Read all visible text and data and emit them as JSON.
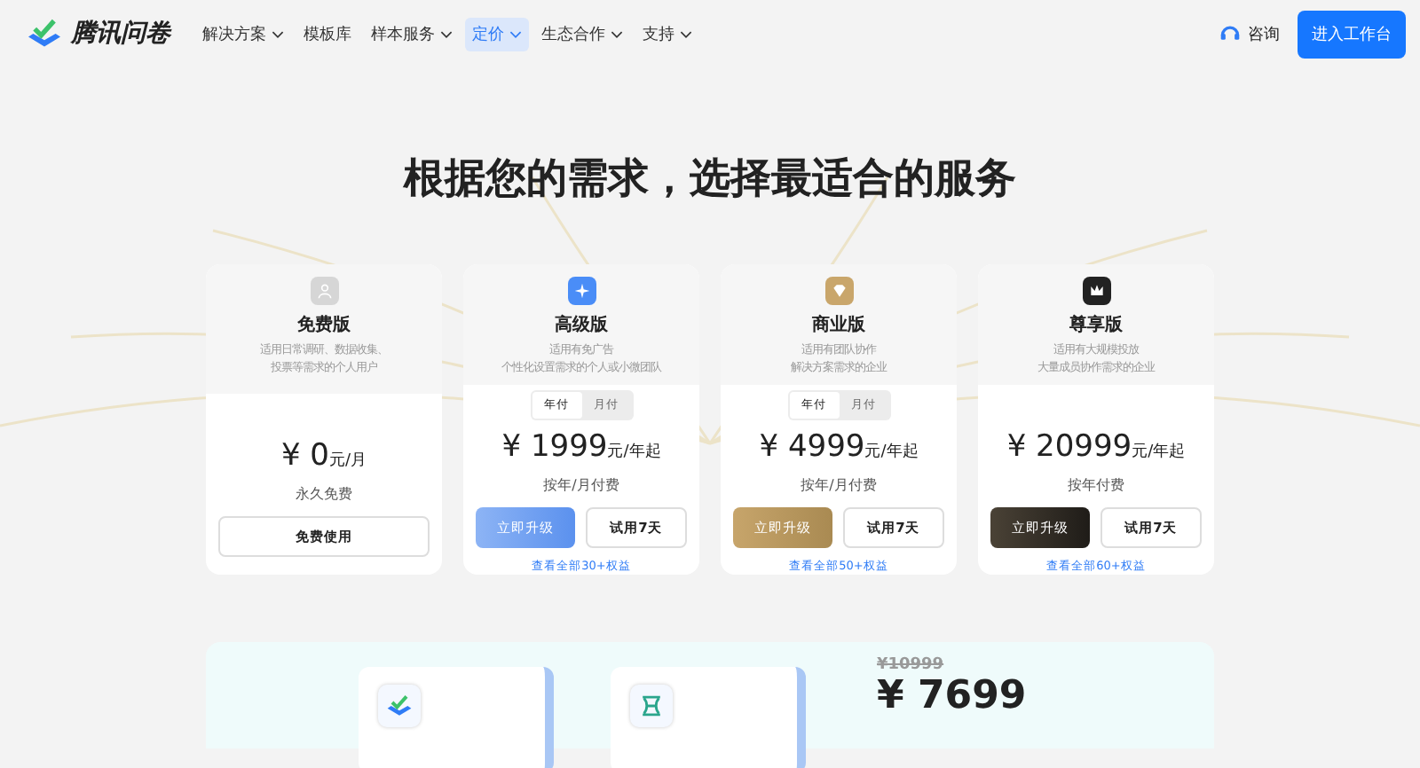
{
  "nav": {
    "brand": "腾讯问卷",
    "items": [
      {
        "label": "解决方案",
        "dropdown": true,
        "selected": false
      },
      {
        "label": "模板库",
        "dropdown": false,
        "selected": false
      },
      {
        "label": "样本服务",
        "dropdown": true,
        "selected": false
      },
      {
        "label": "定价",
        "dropdown": true,
        "selected": true
      },
      {
        "label": "生态合作",
        "dropdown": true,
        "selected": false
      },
      {
        "label": "支持",
        "dropdown": true,
        "selected": false
      }
    ],
    "consult": "咨询",
    "cta": "进入工作台"
  },
  "heading": "根据您的需求，选择最适合的服务",
  "plans": [
    {
      "kind": "free",
      "name": "免费版",
      "desc": [
        "适用日常调研、数据收集、",
        "投票等需求的个人用户"
      ],
      "price": "¥ 0",
      "unit": "元/月",
      "note": "永久免费",
      "buttons": [
        {
          "label": "免费使用",
          "kind": "outline"
        }
      ]
    },
    {
      "kind": "premium",
      "name": "高级版",
      "desc": [
        "适用有免广告",
        "个性化设置需求的个人或小微团队"
      ],
      "billing": [
        {
          "label": "年付",
          "selected": true
        },
        {
          "label": "月付",
          "selected": false
        }
      ],
      "price": "¥ 1999",
      "unit": "元/年起",
      "note": "按年/月付费",
      "buttons": [
        {
          "label": "立即升级",
          "kind": "primary"
        },
        {
          "label": "试用7天",
          "kind": "outline"
        }
      ],
      "link": "查看全部30+权益"
    },
    {
      "kind": "business",
      "name": "商业版",
      "desc": [
        "适用有团队协作",
        "解决方案需求的企业"
      ],
      "billing": [
        {
          "label": "年付",
          "selected": true
        },
        {
          "label": "月付",
          "selected": false
        }
      ],
      "price": "¥ 4999",
      "unit": "元/年起",
      "note": "按年/月付费",
      "buttons": [
        {
          "label": "立即升级",
          "kind": "primary"
        },
        {
          "label": "试用7天",
          "kind": "outline"
        }
      ],
      "link": "查看全部50+权益"
    },
    {
      "kind": "exclusive",
      "name": "尊享版",
      "desc": [
        "适用有大规模投放",
        "大量成员协作需求的企业"
      ],
      "price": "¥ 20999",
      "unit": "元/年起",
      "note": "按年付费",
      "buttons": [
        {
          "label": "立即升级",
          "kind": "primary"
        },
        {
          "label": "试用7天",
          "kind": "outline"
        }
      ],
      "link": "查看全部60+权益"
    }
  ],
  "promo": {
    "old_price": "¥10999",
    "price": "¥ 7699"
  }
}
